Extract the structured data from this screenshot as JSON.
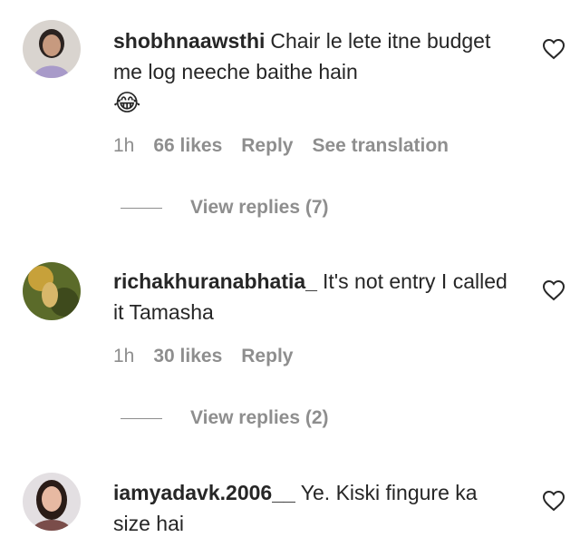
{
  "comments": [
    {
      "username": "shobhnaawsthi",
      "text": "Chair le lete itne budget me log neeche baithe hain",
      "emoji": "😂",
      "time": "1h",
      "likes": "66 likes",
      "reply": "Reply",
      "translate": "See translation",
      "view_replies": "View replies (7)"
    },
    {
      "username": "richakhuranabhatia_",
      "text": "It's not entry I called it Tamasha",
      "time": "1h",
      "likes": "30 likes",
      "reply": "Reply",
      "view_replies": "View replies (2)"
    },
    {
      "username": "iamyadavk.2006__",
      "text": "Ye. Kiski fingure ka size hai"
    }
  ],
  "colors": {
    "text": "#262626",
    "secondary": "#8e8e8e",
    "background": "#ffffff"
  },
  "icons": {
    "like": "heart-outline-icon"
  }
}
